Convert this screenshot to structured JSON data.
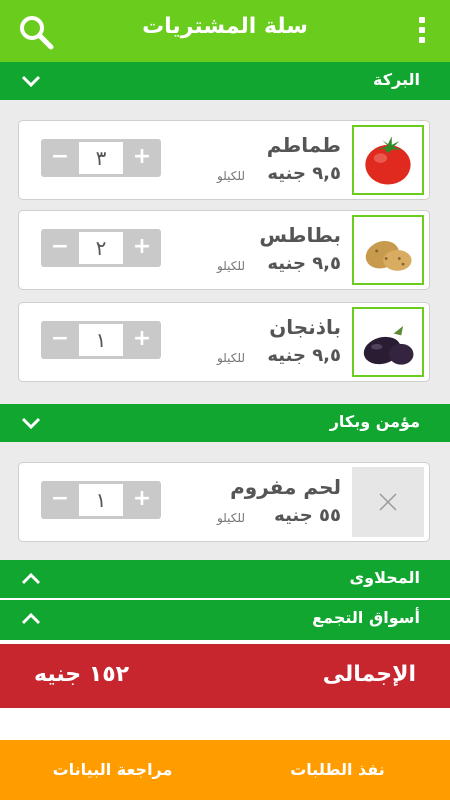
{
  "app": {
    "title": "سلة المشتريات"
  },
  "sections": [
    {
      "name": "البركة",
      "expanded": true,
      "items": [
        {
          "name": "طماطم",
          "price": "٩,٥ جنيه",
          "unit": "للكيلو",
          "qty": "٣",
          "image": "tomato-icon"
        },
        {
          "name": "بطاطس",
          "price": "٩,٥ جنيه",
          "unit": "للكيلو",
          "qty": "٢",
          "image": "potato-icon"
        },
        {
          "name": "باذنجان",
          "price": "٩,٥ جنيه",
          "unit": "للكيلو",
          "qty": "١",
          "image": "eggplant-icon"
        }
      ]
    },
    {
      "name": "مؤمن وبكار",
      "expanded": true,
      "items": [
        {
          "name": "لحم مفروم",
          "price": "٥٥ جنيه",
          "unit": "للكيلو",
          "qty": "١",
          "image": "placeholder-x-icon"
        }
      ]
    },
    {
      "name": "المحلاوى",
      "expanded": false
    },
    {
      "name": "أسواق التجمع",
      "expanded": false
    }
  ],
  "stepper": {
    "minus": "−",
    "plus": "+"
  },
  "total": {
    "label": "الإجمالى",
    "value": "١٥٢ جنيه"
  },
  "actions": {
    "execute": "نفذ الطلبات",
    "review": "مراجعة البيانات"
  },
  "colors": {
    "topbar": "#6acc1c",
    "section": "#10a62f",
    "total": "#c8262e",
    "actions": "#ff9c00"
  }
}
